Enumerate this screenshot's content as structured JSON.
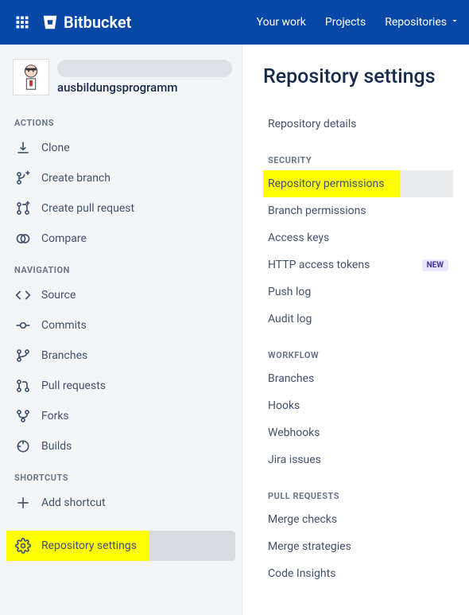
{
  "header": {
    "brand": "Bitbucket",
    "nav": {
      "your_work": "Your work",
      "projects": "Projects",
      "repositories": "Repositories"
    }
  },
  "sidebar": {
    "repo_name": "ausbildungsprogramm",
    "sections": {
      "actions": {
        "title": "ACTIONS",
        "clone": "Clone",
        "create_branch": "Create branch",
        "create_pull_request": "Create pull request",
        "compare": "Compare"
      },
      "navigation": {
        "title": "NAVIGATION",
        "source": "Source",
        "commits": "Commits",
        "branches": "Branches",
        "pull_requests": "Pull requests",
        "forks": "Forks",
        "builds": "Builds"
      },
      "shortcuts": {
        "title": "SHORTCUTS",
        "add_shortcut": "Add shortcut"
      },
      "repository_settings": "Repository settings"
    }
  },
  "settings_panel": {
    "title": "Repository settings",
    "repository_details": "Repository details",
    "security": {
      "title": "SECURITY",
      "repository_permissions": "Repository permissions",
      "branch_permissions": "Branch permissions",
      "access_keys": "Access keys",
      "http_access_tokens": "HTTP access tokens",
      "http_badge": "NEW",
      "push_log": "Push log",
      "audit_log": "Audit log"
    },
    "workflow": {
      "title": "WORKFLOW",
      "branches": "Branches",
      "hooks": "Hooks",
      "webhooks": "Webhooks",
      "jira_issues": "Jira issues"
    },
    "pull_requests": {
      "title": "PULL REQUESTS",
      "merge_checks": "Merge checks",
      "merge_strategies": "Merge strategies",
      "code_insights": "Code Insights"
    }
  }
}
